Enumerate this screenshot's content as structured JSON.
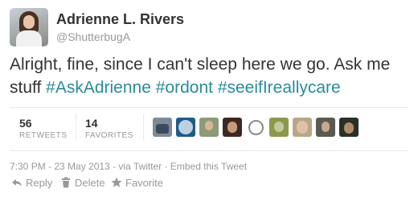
{
  "author": {
    "name": "Adrienne L. Rivers",
    "handle": "@ShutterbugA"
  },
  "tweet": {
    "text_plain": "Alright, fine, since I can't sleep here we go. Ask me stuff ",
    "hashtags": [
      "#AskAdrienne",
      "#ordont",
      "#seeifIreallycare"
    ]
  },
  "stats": {
    "retweets": {
      "count": "56",
      "label": "RETWEETS"
    },
    "favorites": {
      "count": "14",
      "label": "FAVORITES"
    }
  },
  "favoriter_avatar_count": 9,
  "meta": {
    "timestamp": "7:30 PM - 23 May 2013",
    "via": "via Twitter",
    "embed": "Embed this Tweet"
  },
  "actions": {
    "reply": "Reply",
    "delete": "Delete",
    "favorite": "Favorite"
  },
  "colors": {
    "hashtag": "#2a8c9c",
    "muted": "#999999",
    "text": "#333333"
  }
}
